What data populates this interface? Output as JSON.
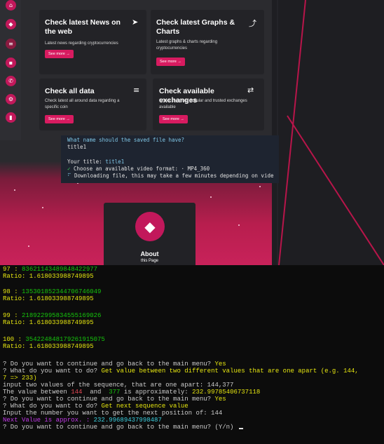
{
  "cards": [
    {
      "title": "Check latest News on the web",
      "desc": "Latest news regarding cryptocurrencies",
      "button": "See more →",
      "icon": "paper-plane-icon"
    },
    {
      "title": "Check latest Graphs & Charts",
      "desc": "Latest graphs & charts regarding cryptocurrencies",
      "button": "See more →",
      "icon": "chart-icon"
    },
    {
      "title": "Check all data",
      "desc": "Check latest all around data regarding a specific coin",
      "button": "See more →",
      "icon": "database-icon"
    },
    {
      "title": "Check available exchanges",
      "desc": "Check the most popular and trusted exchanges available",
      "button": "See more →",
      "icon": "exchange-icon"
    }
  ],
  "about": {
    "title": "About",
    "subtitle": "this Page"
  },
  "vscode": {
    "line1": "What name should the saved file have?",
    "line2": "title1",
    "line3": "Your title: title1",
    "line4_check": "✓",
    "line4": "Choose an available video format: · MP4_360",
    "line5": "Downloading file, this may take a few minutes depending on vide"
  },
  "terminal": {
    "r97_n": "97 : ",
    "r97_v": "83621143489848422977",
    "r97_ratio": "Ratio: 1.618033988749895",
    "r98_n": "98 : ",
    "r98_v": "135301852344706746049",
    "r98_ratio": "Ratio: 1.618033988749895",
    "r99_n": "99 : ",
    "r99_v": "218922995834555169026",
    "r99_ratio": "Ratio: 1.618033988749895",
    "r100_n": "100 : ",
    "r100_v": "354224848179261915075",
    "r100_ratio": "Ratio: 1.618033988749895",
    "q1": "? Do you want to continue and go back to the main menu? ",
    "a1": "Yes",
    "q2": "? What do you want to do? ",
    "a2a": "Get value between two different values that are one apart (e.g. 144,",
    "a2b": "7 => 233)",
    "l3": "input two values of the sequence, that are one apart: 144,377",
    "l4a": "The value between ",
    "l4b": "144",
    "l4c": "  and  ",
    "l4d": "377",
    "l4e": " is approximately: ",
    "l4f": "232.99785406737118",
    "q5": "? Do you want to continue and go back to the main menu? ",
    "a5": "Yes",
    "q6": "? What do you want to do? ",
    "a6": "Get next sequence value",
    "l7": "Input the number you want to get the next position of: 144",
    "l8a": "Next Value is approx. : ",
    "l8b": "232.99689437998487",
    "q9": "? Do you want to continue and go back to the main menu? (Y/n) "
  },
  "colors": {
    "accent": "#d81b60",
    "terminal_bg": "#0c0c0c",
    "vscode_bg": "#1e2430"
  }
}
